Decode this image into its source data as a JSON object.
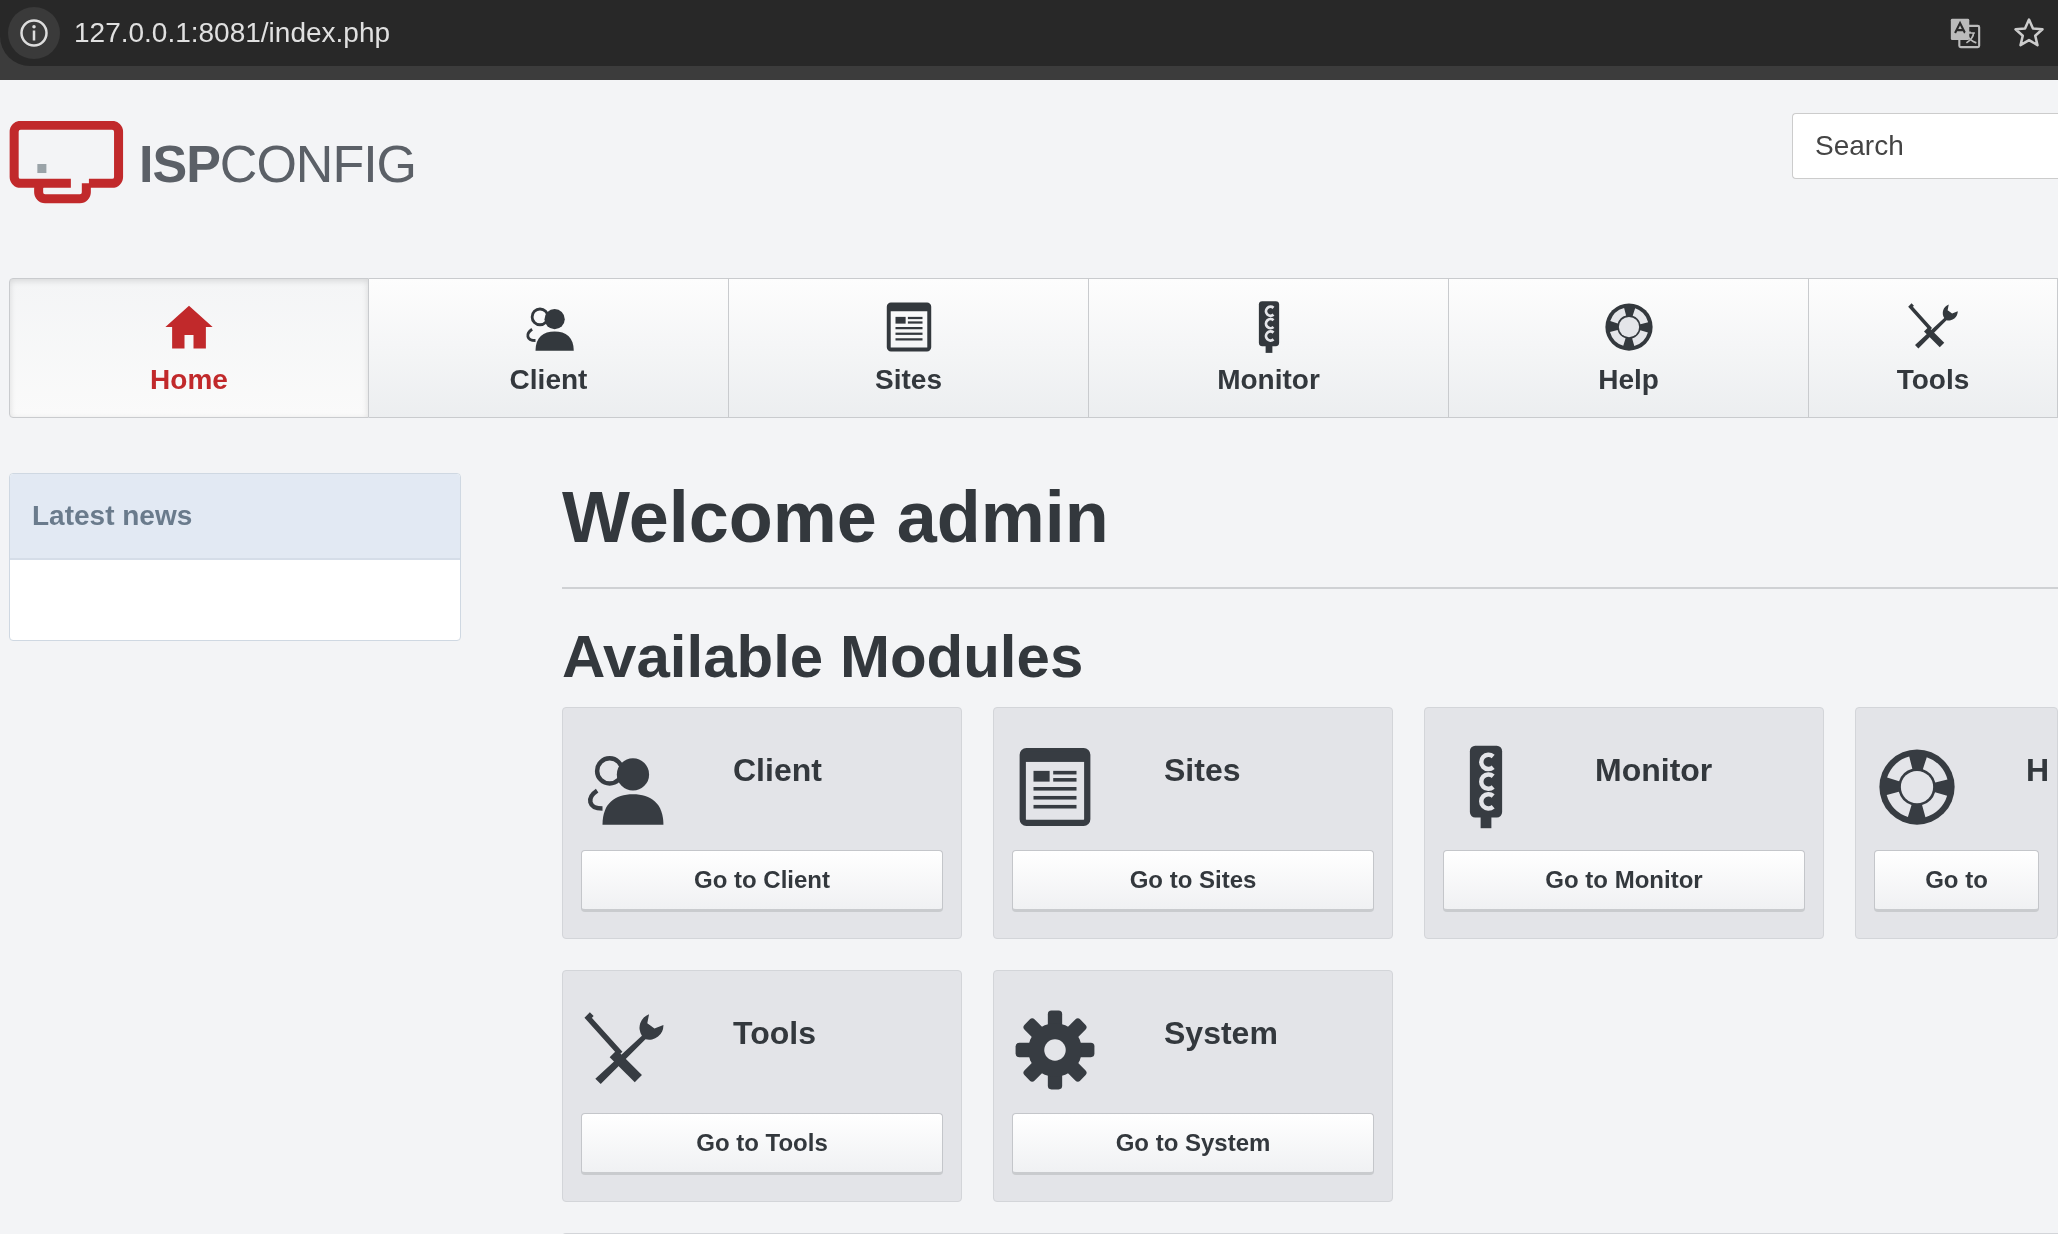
{
  "browser": {
    "url": "127.0.0.1:8081/index.php"
  },
  "header": {
    "logo": "**ISP**CONFIG",
    "search": {
      "placeholder": "Search"
    }
  },
  "tabs": [
    {
      "label": "Home",
      "kind": "home",
      "selected": true
    },
    {
      "label": "Client",
      "kind": "client",
      "selected": false
    },
    {
      "label": "Sites",
      "kind": "sites",
      "selected": false
    },
    {
      "label": "Monitor",
      "kind": "monitor",
      "selected": false
    },
    {
      "label": "Help",
      "kind": "help",
      "selected": false
    },
    {
      "label": "Tools",
      "kind": "tools",
      "selected": false
    }
  ],
  "sidebar": {
    "title": "Latest news"
  },
  "main": {
    "title": "Welcome admin",
    "subtitle": "Available Modules",
    "modules": [
      {
        "title": "Client",
        "button": "Go to Client",
        "kind": "client"
      },
      {
        "title": "Sites",
        "button": "Go to Sites",
        "kind": "sites"
      },
      {
        "title": "Monitor",
        "button": "Go to Monitor",
        "kind": "monitor"
      },
      {
        "title": "H",
        "button": "Go to",
        "kind": "help"
      },
      {
        "title": "Tools",
        "button": "Go to Tools",
        "kind": "tools"
      },
      {
        "title": "System",
        "button": "Go to System",
        "kind": "system"
      }
    ]
  }
}
